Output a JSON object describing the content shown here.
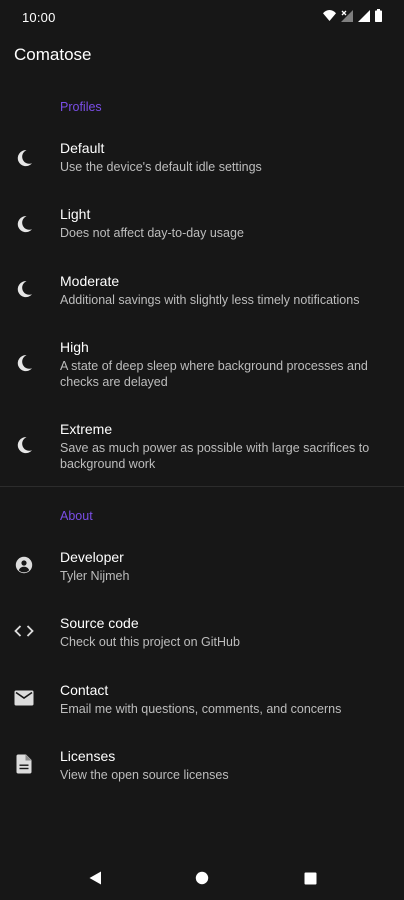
{
  "status_bar": {
    "time": "10:00",
    "icons": [
      "wifi-icon",
      "signal-x-icon",
      "signal-icon",
      "battery-icon"
    ]
  },
  "app": {
    "title": "Comatose"
  },
  "sections": {
    "profiles": {
      "header": "Profiles",
      "items": [
        {
          "icon": "moon-icon",
          "title": "Default",
          "summary": "Use the device's default idle settings"
        },
        {
          "icon": "moon-icon",
          "title": "Light",
          "summary": "Does not affect day-to-day usage"
        },
        {
          "icon": "moon-icon",
          "title": "Moderate",
          "summary": "Additional savings with slightly less timely notifications"
        },
        {
          "icon": "moon-icon",
          "title": "High",
          "summary": "A state of deep sleep where background processes and checks are delayed"
        },
        {
          "icon": "moon-icon",
          "title": "Extreme",
          "summary": "Save as much power as possible with large sacrifices to background work"
        }
      ]
    },
    "about": {
      "header": "About",
      "items": [
        {
          "icon": "account-circle-icon",
          "title": "Developer",
          "summary": "Tyler Nijmeh"
        },
        {
          "icon": "code-icon",
          "title": "Source code",
          "summary": "Check out this project on GitHub"
        },
        {
          "icon": "mail-icon",
          "title": "Contact",
          "summary": "Email me with questions, comments, and concerns"
        },
        {
          "icon": "document-icon",
          "title": "Licenses",
          "summary": "View the open source licenses"
        }
      ]
    }
  },
  "nav_bar": {
    "buttons": [
      "back-icon",
      "home-icon",
      "recents-icon"
    ]
  },
  "colors": {
    "background": "#171717",
    "accent": "#7a4ee6",
    "text_primary": "#ffffff",
    "text_secondary": "#bdbdbd"
  }
}
